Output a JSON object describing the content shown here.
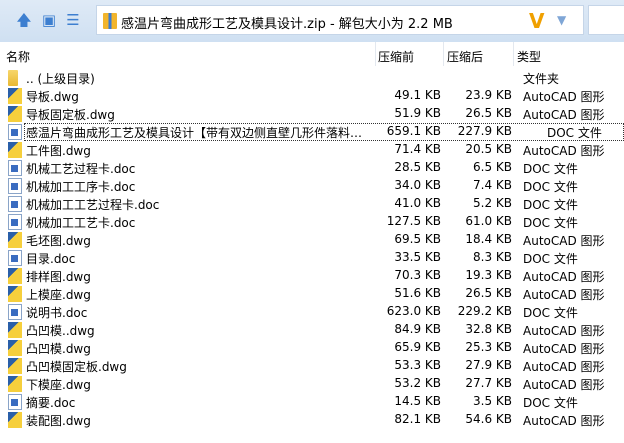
{
  "address": {
    "title": "感温片弯曲成形工艺及模具设计.zip - 解包大小为 2.2 MB"
  },
  "columns": {
    "name": "名称",
    "before": "压缩前",
    "after": "压缩后",
    "type": "类型"
  },
  "rows": [
    {
      "name": ".. (上级目录)",
      "before": "",
      "after": "",
      "type": "文件夹",
      "icon": "folder"
    },
    {
      "name": "导板.dwg",
      "before": "49.1 KB",
      "after": "23.9 KB",
      "type": "AutoCAD 图形",
      "icon": "dwg"
    },
    {
      "name": "导板固定板.dwg",
      "before": "51.9 KB",
      "after": "26.5 KB",
      "type": "AutoCAD 图形",
      "icon": "dwg"
    },
    {
      "name": "感温片弯曲成形工艺及模具设计【带有双边侧直壁几形件落料弯...",
      "before": "659.1 KB",
      "after": "227.9 KB",
      "type": "DOC 文件",
      "icon": "doc"
    },
    {
      "name": "工件图.dwg",
      "before": "71.4 KB",
      "after": "20.5 KB",
      "type": "AutoCAD 图形",
      "icon": "dwg"
    },
    {
      "name": "机械工艺过程卡.doc",
      "before": "28.5 KB",
      "after": "6.5 KB",
      "type": "DOC 文件",
      "icon": "doc"
    },
    {
      "name": "机械加工工序卡.doc",
      "before": "34.0 KB",
      "after": "7.4 KB",
      "type": "DOC 文件",
      "icon": "doc"
    },
    {
      "name": "机械加工工艺过程卡.doc",
      "before": "41.0 KB",
      "after": "5.2 KB",
      "type": "DOC 文件",
      "icon": "doc"
    },
    {
      "name": "机械加工工艺卡.doc",
      "before": "127.5 KB",
      "after": "61.0 KB",
      "type": "DOC 文件",
      "icon": "doc"
    },
    {
      "name": "毛坯图.dwg",
      "before": "69.5 KB",
      "after": "18.4 KB",
      "type": "AutoCAD 图形",
      "icon": "dwg"
    },
    {
      "name": "目录.doc",
      "before": "33.5 KB",
      "after": "8.3 KB",
      "type": "DOC 文件",
      "icon": "doc"
    },
    {
      "name": "排样图.dwg",
      "before": "70.3 KB",
      "after": "19.3 KB",
      "type": "AutoCAD 图形",
      "icon": "dwg"
    },
    {
      "name": "上模座.dwg",
      "before": "51.6 KB",
      "after": "26.5 KB",
      "type": "AutoCAD 图形",
      "icon": "dwg"
    },
    {
      "name": "说明书.doc",
      "before": "623.0 KB",
      "after": "229.2 KB",
      "type": "DOC 文件",
      "icon": "doc"
    },
    {
      "name": "凸凹模..dwg",
      "before": "84.9 KB",
      "after": "32.8 KB",
      "type": "AutoCAD 图形",
      "icon": "dwg"
    },
    {
      "name": "凸凹模.dwg",
      "before": "65.9 KB",
      "after": "25.3 KB",
      "type": "AutoCAD 图形",
      "icon": "dwg"
    },
    {
      "name": "凸凹模固定板.dwg",
      "before": "53.3 KB",
      "after": "27.9 KB",
      "type": "AutoCAD 图形",
      "icon": "dwg"
    },
    {
      "name": "下模座.dwg",
      "before": "53.2 KB",
      "after": "27.7 KB",
      "type": "AutoCAD 图形",
      "icon": "dwg"
    },
    {
      "name": "摘要.doc",
      "before": "14.5 KB",
      "after": "3.5 KB",
      "type": "DOC 文件",
      "icon": "doc"
    },
    {
      "name": "装配图.dwg",
      "before": "82.1 KB",
      "after": "54.6 KB",
      "type": "AutoCAD 图形",
      "icon": "dwg"
    }
  ]
}
